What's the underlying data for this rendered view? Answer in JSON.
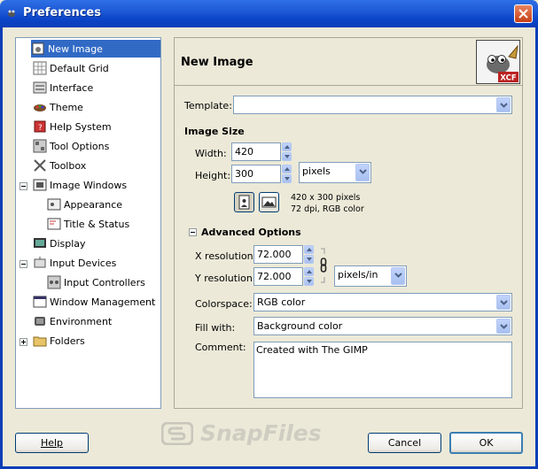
{
  "window": {
    "title": "Preferences"
  },
  "sidebar": {
    "items": [
      {
        "label": "New Image"
      },
      {
        "label": "Default Grid"
      },
      {
        "label": "Interface"
      },
      {
        "label": "Theme"
      },
      {
        "label": "Help System"
      },
      {
        "label": "Tool Options"
      },
      {
        "label": "Toolbox"
      },
      {
        "label": "Image Windows"
      },
      {
        "label": "Appearance"
      },
      {
        "label": "Title & Status"
      },
      {
        "label": "Display"
      },
      {
        "label": "Input Devices"
      },
      {
        "label": "Input Controllers"
      },
      {
        "label": "Window Management"
      },
      {
        "label": "Environment"
      },
      {
        "label": "Folders"
      }
    ]
  },
  "panel": {
    "heading": "New Image",
    "icon_label": "XCF",
    "template": {
      "label": "Template:",
      "value": ""
    },
    "image_size": {
      "heading": "Image Size",
      "width_label": "Width:",
      "width_value": "420",
      "height_label": "Height:",
      "height_value": "300",
      "unit": "pixels",
      "info_line1": "420 x 300 pixels",
      "info_line2": "72 dpi, RGB color"
    },
    "advanced": {
      "heading": "Advanced Options",
      "xres_label": "X resolution:",
      "xres_value": "72.000",
      "yres_label": "Y resolution:",
      "yres_value": "72.000",
      "res_unit": "pixels/in",
      "colorspace_label": "Colorspace:",
      "colorspace_value": "RGB color",
      "fill_label": "Fill with:",
      "fill_value": "Background color",
      "comment_label": "Comment:",
      "comment_value": "Created with The GIMP"
    }
  },
  "buttons": {
    "help": "Help",
    "cancel": "Cancel",
    "ok": "OK"
  },
  "watermark": "SnapFiles",
  "colors": {
    "titlebar": "#0A3DB8",
    "selection": "#316AC5",
    "window_bg": "#ECE9D8"
  }
}
